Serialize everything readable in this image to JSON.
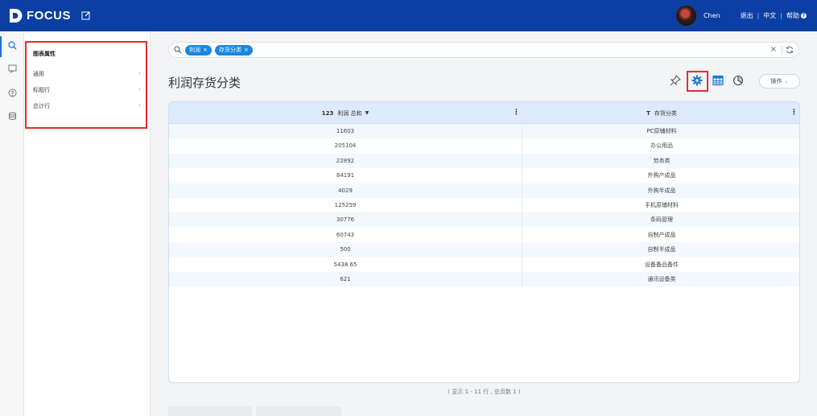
{
  "app": {
    "logo_text": "FOCUS",
    "user_name": "Chen",
    "logout": "退出",
    "language": "中文",
    "help": "帮助"
  },
  "panel": {
    "title": "图表属性",
    "items": [
      {
        "label": "通用"
      },
      {
        "label": "标题行"
      },
      {
        "label": "总计行"
      }
    ]
  },
  "search": {
    "tokens": [
      {
        "label": "利润"
      },
      {
        "label": "存货分类"
      }
    ]
  },
  "page": {
    "title": "利润存货分类",
    "action_label": "操作",
    "footer_note": "( 显示 1 - 11 行 , 总页数 1 )"
  },
  "table": {
    "columns": [
      {
        "type_badge": "123",
        "label": "利润 总和"
      },
      {
        "type_badge": "T",
        "label": "存货分类"
      }
    ],
    "rows": [
      [
        "11603",
        "PC原辅材料"
      ],
      [
        "205104",
        "办公用品"
      ],
      [
        "22892",
        "劳务类"
      ],
      [
        "84191",
        "外购产成品"
      ],
      [
        "4029",
        "外购半成品"
      ],
      [
        "125259",
        "手机原辅材料"
      ],
      [
        "30776",
        "条码管理"
      ],
      [
        "60743",
        "自制产成品"
      ],
      [
        "500",
        "自制半成品"
      ],
      [
        "5438.65",
        "设备备品备件"
      ],
      [
        "621",
        "通讯设备类"
      ]
    ]
  },
  "colors": {
    "topbar": "#0b3fa3",
    "chip": "#1787e6",
    "highlight": "#e52c2c",
    "header_row": "#dceafb"
  }
}
